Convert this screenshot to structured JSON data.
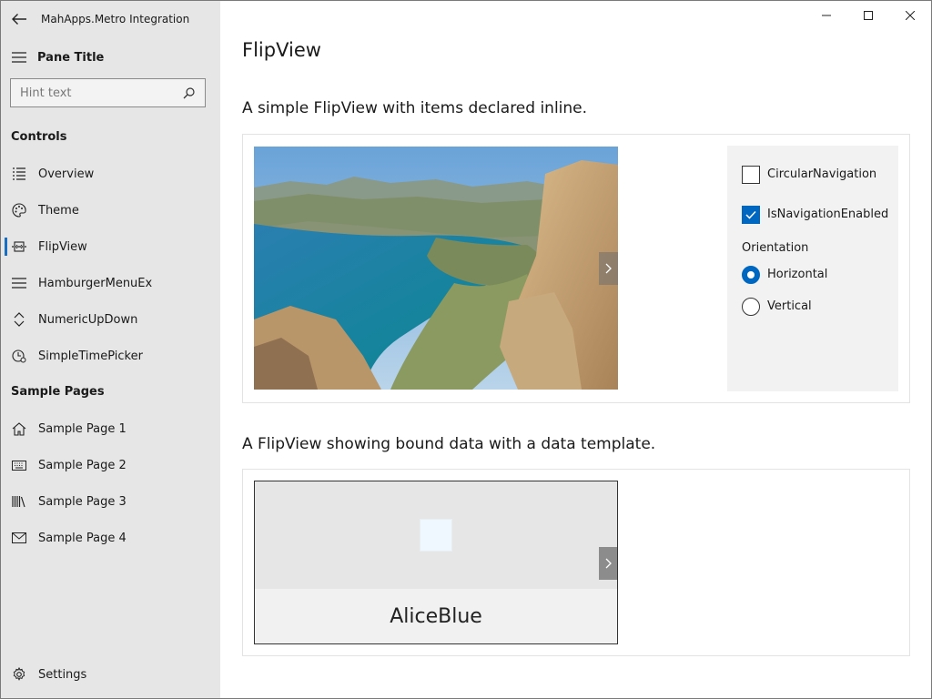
{
  "window": {
    "title": "MahApps.Metro Integration",
    "caption_buttons": [
      "minimize-icon",
      "maximize-icon",
      "close-icon"
    ]
  },
  "pane": {
    "title": "Pane Title",
    "search": {
      "placeholder": "Hint text",
      "value": ""
    },
    "sections": [
      {
        "header": "Controls",
        "items": [
          {
            "label": "Overview",
            "icon": "list-icon"
          },
          {
            "label": "Theme",
            "icon": "palette-icon"
          },
          {
            "label": "FlipView",
            "icon": "flipview-icon",
            "selected": true
          },
          {
            "label": "HamburgerMenuEx",
            "icon": "hamburger-icon"
          },
          {
            "label": "NumericUpDown",
            "icon": "updown-icon"
          },
          {
            "label": "SimpleTimePicker",
            "icon": "clock-icon"
          }
        ]
      },
      {
        "header": "Sample Pages",
        "items": [
          {
            "label": "Sample Page 1",
            "icon": "home-icon"
          },
          {
            "label": "Sample Page 2",
            "icon": "keyboard-icon"
          },
          {
            "label": "Sample Page 3",
            "icon": "library-icon"
          },
          {
            "label": "Sample Page 4",
            "icon": "mail-icon"
          }
        ]
      }
    ],
    "footer": {
      "label": "Settings",
      "icon": "gear-icon"
    }
  },
  "main": {
    "page_title": "FlipView",
    "section1": {
      "title": "A simple FlipView with items declared inline.",
      "options": {
        "circular_navigation": {
          "label": "CircularNavigation",
          "checked": false
        },
        "navigation_enabled": {
          "label": "IsNavigationEnabled",
          "checked": true
        },
        "orientation_label": "Orientation",
        "orientation_options": [
          {
            "label": "Horizontal",
            "checked": true
          },
          {
            "label": "Vertical",
            "checked": false
          }
        ]
      }
    },
    "section2": {
      "title": "A FlipView showing bound data with a data template.",
      "item_name": "AliceBlue",
      "item_color": "#F0F8FF"
    }
  },
  "colors": {
    "accent": "#0067C0",
    "pane_bg": "#E6E6E6"
  }
}
